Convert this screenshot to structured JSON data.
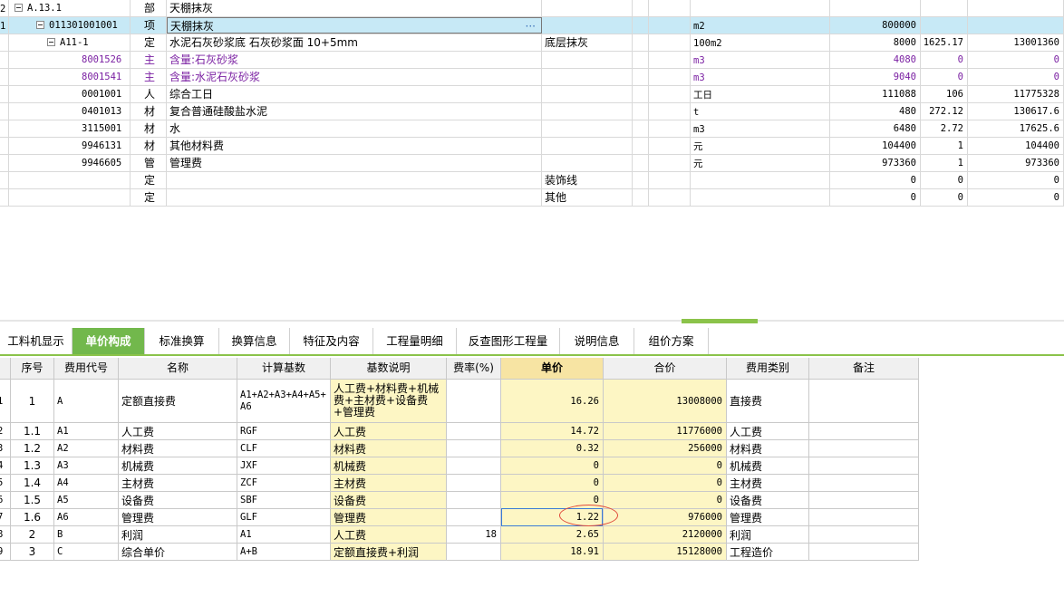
{
  "upper_grid": {
    "rows": [
      {
        "num": "2",
        "code": "A.13.1",
        "type": "部",
        "name": "天棚抹灰",
        "desc": "",
        "unit": "",
        "qty": "",
        "price": "",
        "total": "",
        "checkbox": true,
        "toggle": true,
        "indent": 0
      },
      {
        "num": "1",
        "code": "011301001001",
        "type": "项",
        "name": "天棚抹灰",
        "desc": "",
        "unit": "m2",
        "qty": "800000",
        "price": "",
        "total": "",
        "checkbox": true,
        "toggle": true,
        "indent": 1,
        "more": "···"
      },
      {
        "num": "",
        "code": "A11-1",
        "type": "定",
        "name": "水泥石灰砂浆底 石灰砂浆面 10+5mm",
        "desc": "底层抹灰",
        "unit": "100m2",
        "qty": "8000",
        "price": "1625.17",
        "total": "13001360",
        "toggle": true,
        "indent": 2
      },
      {
        "num": "",
        "code": "8001526",
        "type": "主",
        "name": "含量:石灰砂浆",
        "desc": "",
        "unit": "m3",
        "qty": "4080",
        "price": "0",
        "total": "0",
        "purple": true,
        "indent": 3
      },
      {
        "num": "",
        "code": "8001541",
        "type": "主",
        "name": "含量:水泥石灰砂浆",
        "desc": "",
        "unit": "m3",
        "qty": "9040",
        "price": "0",
        "total": "0",
        "purple": true,
        "indent": 3
      },
      {
        "num": "",
        "code": "0001001",
        "type": "人",
        "name": "综合工日",
        "desc": "",
        "unit": "工日",
        "qty": "111088",
        "price": "106",
        "total": "11775328",
        "indent": 3
      },
      {
        "num": "",
        "code": "0401013",
        "type": "材",
        "name": "复合普通硅酸盐水泥",
        "desc": "",
        "unit": "t",
        "qty": "480",
        "price": "272.12",
        "total": "130617.6",
        "indent": 3
      },
      {
        "num": "",
        "code": "3115001",
        "type": "材",
        "name": "水",
        "desc": "",
        "unit": "m3",
        "qty": "6480",
        "price": "2.72",
        "total": "17625.6",
        "indent": 3
      },
      {
        "num": "",
        "code": "9946131",
        "type": "材",
        "name": "其他材料费",
        "desc": "",
        "unit": "元",
        "qty": "104400",
        "price": "1",
        "total": "104400",
        "indent": 3
      },
      {
        "num": "",
        "code": "9946605",
        "type": "管",
        "name": "管理费",
        "desc": "",
        "unit": "元",
        "qty": "973360",
        "price": "1",
        "total": "973360",
        "indent": 3
      },
      {
        "num": "",
        "code": "",
        "type": "定",
        "name": "",
        "desc": "装饰线",
        "unit": "",
        "qty": "0",
        "price": "0",
        "total": "0",
        "indent": 2
      },
      {
        "num": "",
        "code": "",
        "type": "定",
        "name": "",
        "desc": "其他",
        "unit": "",
        "qty": "0",
        "price": "0",
        "total": "0",
        "indent": 2
      }
    ]
  },
  "tabs": [
    {
      "label": "工料机显示"
    },
    {
      "label": "单价构成",
      "active": true
    },
    {
      "label": "标准换算"
    },
    {
      "label": "换算信息"
    },
    {
      "label": "特征及内容"
    },
    {
      "label": "工程量明细"
    },
    {
      "label": "反查图形工程量"
    },
    {
      "label": "说明信息"
    },
    {
      "label": "组价方案"
    }
  ],
  "lower_grid": {
    "headers": [
      "序号",
      "费用代号",
      "名称",
      "计算基数",
      "基数说明",
      "费率(%)",
      "单价",
      "合价",
      "费用类别",
      "备注"
    ],
    "rows": [
      {
        "num": "1",
        "seq": "1",
        "code": "A",
        "name": "定额直接费",
        "base": "A1+A2+A3+A4+A5+A6",
        "base_desc": "人工费+材料费+机械费+主材费+设备费+管理费",
        "rate": "",
        "unit_price": "16.26",
        "total": "13008000",
        "category": "直接费",
        "note": ""
      },
      {
        "num": "2",
        "seq": "1.1",
        "code": "A1",
        "name": "人工费",
        "base": "RGF",
        "base_desc": "人工费",
        "rate": "",
        "unit_price": "14.72",
        "total": "11776000",
        "category": "人工费",
        "note": ""
      },
      {
        "num": "3",
        "seq": "1.2",
        "code": "A2",
        "name": "材料费",
        "base": "CLF",
        "base_desc": "材料费",
        "rate": "",
        "unit_price": "0.32",
        "total": "256000",
        "category": "材料费",
        "note": ""
      },
      {
        "num": "4",
        "seq": "1.3",
        "code": "A3",
        "name": "机械费",
        "base": "JXF",
        "base_desc": "机械费",
        "rate": "",
        "unit_price": "0",
        "total": "0",
        "category": "机械费",
        "note": ""
      },
      {
        "num": "5",
        "seq": "1.4",
        "code": "A4",
        "name": "主材费",
        "base": "ZCF",
        "base_desc": "主材费",
        "rate": "",
        "unit_price": "0",
        "total": "0",
        "category": "主材费",
        "note": ""
      },
      {
        "num": "6",
        "seq": "1.5",
        "code": "A5",
        "name": "设备费",
        "base": "SBF",
        "base_desc": "设备费",
        "rate": "",
        "unit_price": "0",
        "total": "0",
        "category": "设备费",
        "note": ""
      },
      {
        "num": "7",
        "seq": "1.6",
        "code": "A6",
        "name": "管理费",
        "base": "GLF",
        "base_desc": "管理费",
        "rate": "",
        "unit_price": "1.22",
        "total": "976000",
        "category": "管理费",
        "note": ""
      },
      {
        "num": "8",
        "seq": "2",
        "code": "B",
        "name": "利润",
        "base": "A1",
        "base_desc": "人工费",
        "rate": "18",
        "unit_price": "2.65",
        "total": "2120000",
        "category": "利润",
        "note": ""
      },
      {
        "num": "9",
        "seq": "3",
        "code": "C",
        "name": "综合单价",
        "base": "A+B",
        "base_desc": "定额直接费+利润",
        "rate": "",
        "unit_price": "18.91",
        "total": "15128000",
        "category": "工程造价",
        "note": ""
      }
    ]
  },
  "colors": {
    "tab_active": "#72b84c",
    "selected_row": "#c7e9f6",
    "highlight_col": "#fdf6c4",
    "purple_text": "#7a1fa2",
    "annotation": "#e04b3c"
  }
}
